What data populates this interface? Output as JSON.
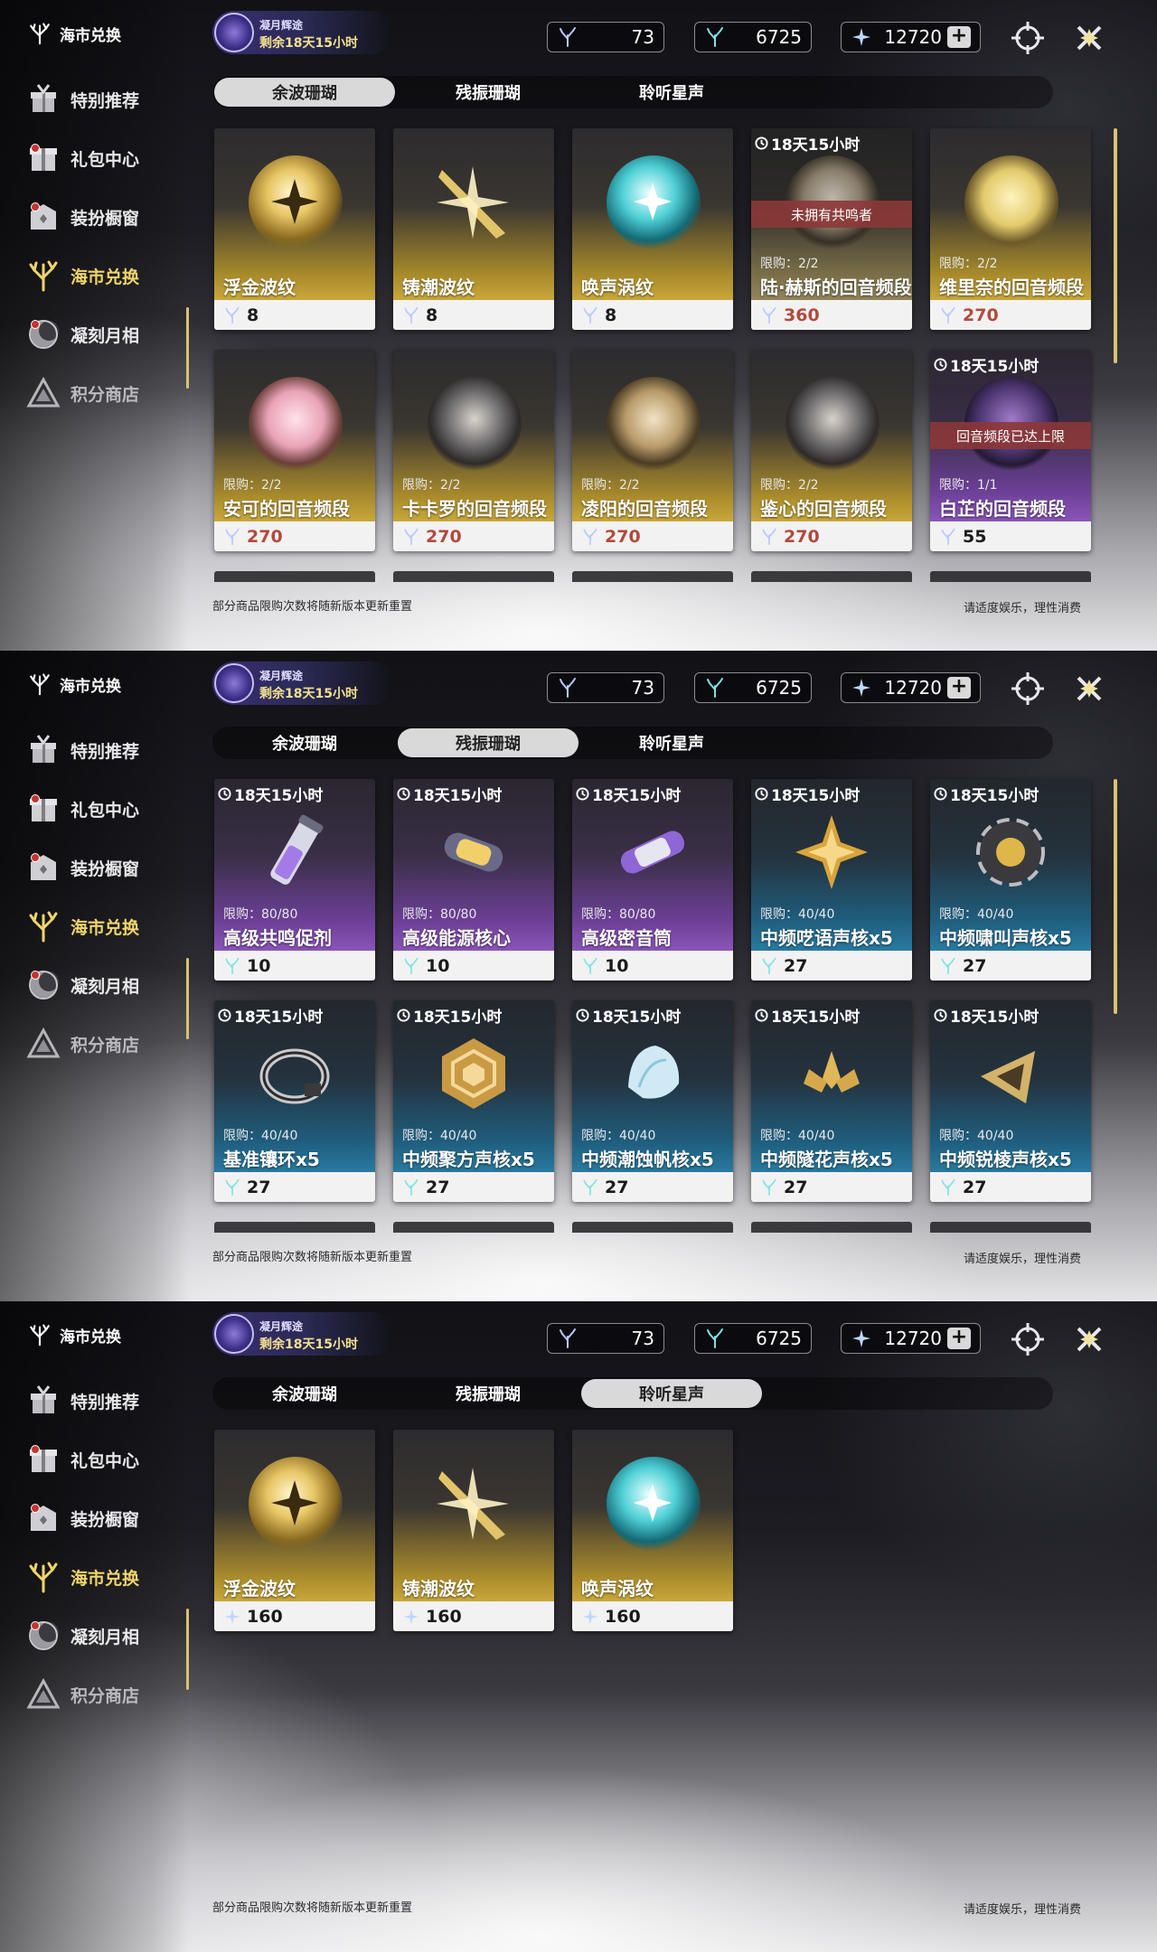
{
  "sidebar": {
    "title": "海市兑换",
    "items": [
      {
        "label": "特别推荐",
        "icon": "gift-box-icon"
      },
      {
        "label": "礼包中心",
        "icon": "package-icon"
      },
      {
        "label": "装扮橱窗",
        "icon": "wardrobe-icon"
      },
      {
        "label": "海市兑换",
        "icon": "coral-icon",
        "active": true
      },
      {
        "label": "凝刻月相",
        "icon": "moon-icon"
      },
      {
        "label": "积分商店",
        "icon": "triangle-icon"
      }
    ]
  },
  "event": {
    "title": "凝月辉途",
    "remaining": "剩余18天15小时"
  },
  "currencies": [
    {
      "value": "73",
      "icon": "afterglow-coral-icon"
    },
    {
      "value": "6725",
      "icon": "oscillate-coral-icon"
    },
    {
      "value": "12720",
      "icon": "lunite-icon"
    }
  ],
  "tabs": [
    "余波珊瑚",
    "残振珊瑚",
    "聆听星声"
  ],
  "footer": {
    "left": "部分商品限购次数将随新版本更新重置",
    "right": "请适度娱乐，理性消费"
  },
  "panels": [
    {
      "selected_tab": 0,
      "items": [
        {
          "name": "浮金波纹",
          "price": "8",
          "art": "gold-orb"
        },
        {
          "name": "铸潮波纹",
          "price": "8",
          "art": "gold-blade"
        },
        {
          "name": "唤声涡纹",
          "price": "8",
          "art": "cyan-orb"
        },
        {
          "name": "陆·赫斯的回音频段",
          "price": "360",
          "limit": "限购：2/2",
          "timer": "18天15小时",
          "banner": "未拥有共鸣者",
          "art": "portrait",
          "faded": true,
          "red": true
        },
        {
          "name": "维里奈的回音频段",
          "price": "270",
          "limit": "限购：2/2",
          "art": "portrait-blonde",
          "red": true
        },
        {
          "name": "安可的回音频段",
          "price": "270",
          "limit": "限购：2/2",
          "art": "portrait-pink",
          "red": true
        },
        {
          "name": "卡卡罗的回音频段",
          "price": "270",
          "limit": "限购：2/2",
          "art": "portrait-dark",
          "red": true
        },
        {
          "name": "凌阳的回音频段",
          "price": "270",
          "limit": "限购：2/2",
          "art": "portrait",
          "red": true
        },
        {
          "name": "鉴心的回音频段",
          "price": "270",
          "limit": "限购：2/2",
          "art": "portrait-dark",
          "red": true
        },
        {
          "name": "白芷的回音频段",
          "price": "55",
          "limit": "限购：1/1",
          "timer": "18天15小时",
          "banner": "回音频段已达上限",
          "art": "portrait-violet",
          "purple": true
        }
      ]
    },
    {
      "selected_tab": 1,
      "items": [
        {
          "name": "高级共鸣促剂",
          "price": "10",
          "limit": "限购：80/80",
          "timer": "18天15小时",
          "art": "vial",
          "purple": true
        },
        {
          "name": "高级能源核心",
          "price": "10",
          "limit": "限购：80/80",
          "timer": "18天15小时",
          "art": "capsule",
          "purple": true
        },
        {
          "name": "高级密音筒",
          "price": "10",
          "limit": "限购：80/80",
          "timer": "18天15小时",
          "art": "tube",
          "purple": true
        },
        {
          "name": "中频呓语声核x5",
          "price": "27",
          "limit": "限购：40/40",
          "timer": "18天15小时",
          "art": "star",
          "blue": true
        },
        {
          "name": "中频啸叫声核x5",
          "price": "27",
          "limit": "限购：40/40",
          "timer": "18天15小时",
          "art": "flower",
          "blue": true
        },
        {
          "name": "基准镶环x5",
          "price": "27",
          "limit": "限购：40/40",
          "timer": "18天15小时",
          "art": "ring",
          "blue": true
        },
        {
          "name": "中频聚方声核x5",
          "price": "27",
          "limit": "限购：40/40",
          "timer": "18天15小时",
          "art": "hex",
          "blue": true
        },
        {
          "name": "中频潮蚀帆核x5",
          "price": "27",
          "limit": "限购：40/40",
          "timer": "18天15小时",
          "art": "shell",
          "blue": true
        },
        {
          "name": "中频隧花声核x5",
          "price": "27",
          "limit": "限购：40/40",
          "timer": "18天15小时",
          "art": "lotus",
          "blue": true
        },
        {
          "name": "中频锐棱声核x5",
          "price": "27",
          "limit": "限购：40/40",
          "timer": "18天15小时",
          "art": "tri",
          "blue": true
        }
      ]
    },
    {
      "selected_tab": 2,
      "items": [
        {
          "name": "浮金波纹",
          "price": "160",
          "art": "gold-orb",
          "lunite": true
        },
        {
          "name": "铸潮波纹",
          "price": "160",
          "art": "gold-blade",
          "lunite": true
        },
        {
          "name": "唤声涡纹",
          "price": "160",
          "art": "cyan-orb",
          "lunite": true
        }
      ]
    }
  ],
  "colors": {
    "gold": "#f1d56a",
    "purple": "#6b3f95",
    "blue": "#1f5d7d",
    "red_price": "#b24a3c",
    "banner": "#8c3737"
  }
}
